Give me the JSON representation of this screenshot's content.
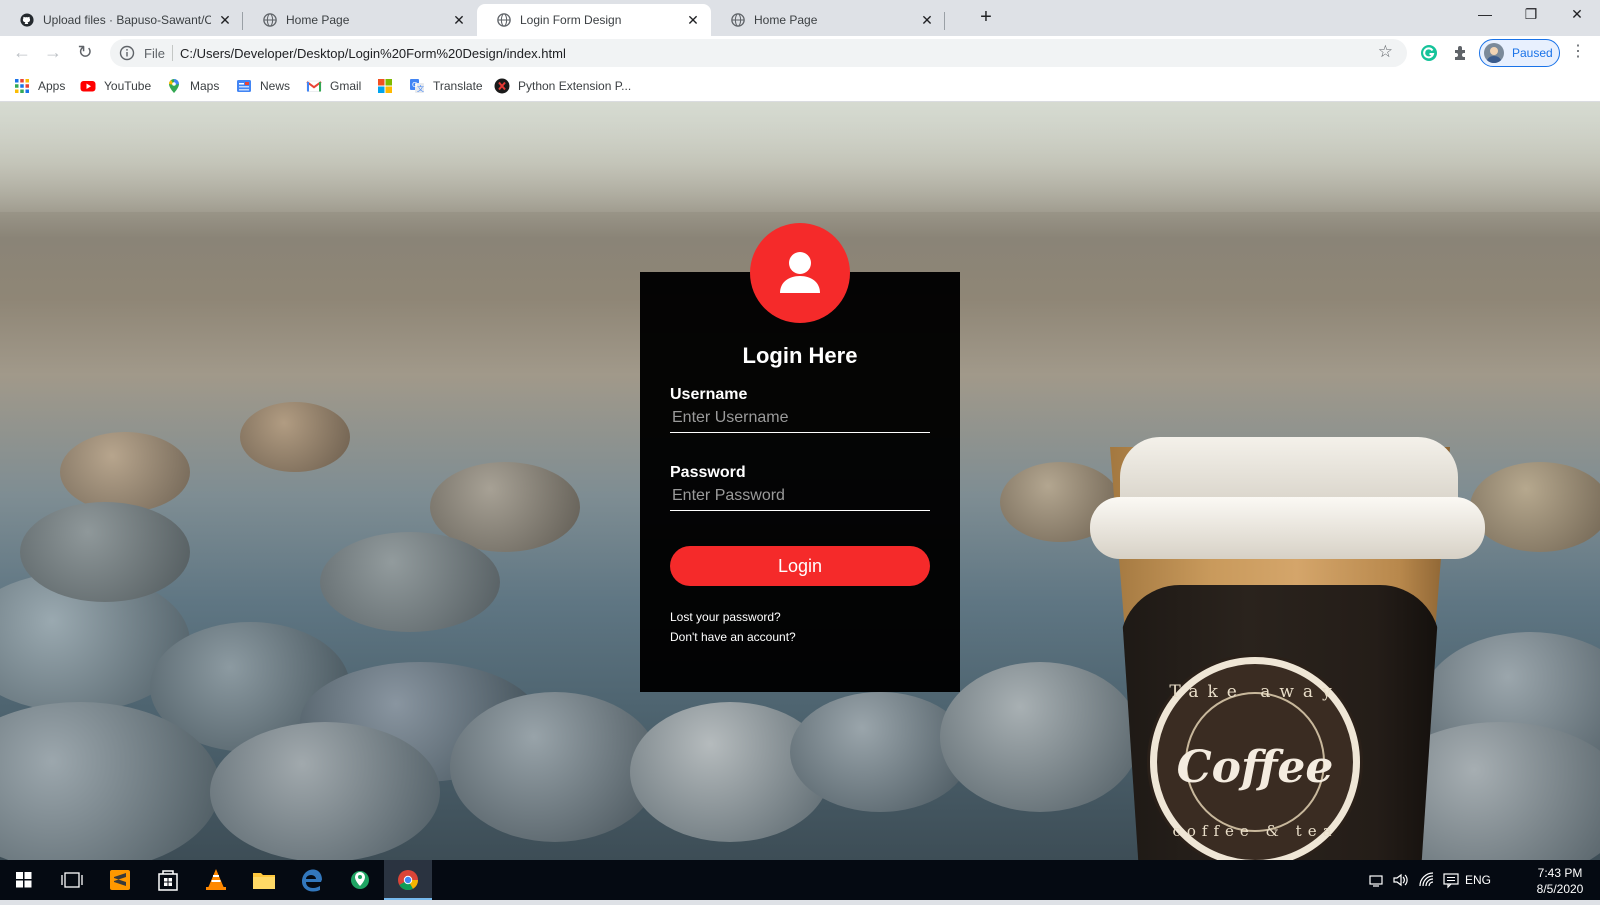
{
  "browser": {
    "tabs": [
      {
        "title": "Upload files · Bapuso-Sawant/CS",
        "icon": "github-icon",
        "active": false
      },
      {
        "title": "Home Page",
        "icon": "globe-icon",
        "active": false
      },
      {
        "title": "Login Form Design",
        "icon": "globe-icon",
        "active": true
      },
      {
        "title": "Home Page",
        "icon": "globe-icon",
        "active": false
      }
    ],
    "address": {
      "scheme_label": "File",
      "url": "C:/Users/Developer/Desktop/Login%20Form%20Design/index.html"
    },
    "profile_label": "Paused",
    "bookmarks": [
      {
        "label": "Apps",
        "icon": "apps-grid-icon"
      },
      {
        "label": "YouTube",
        "icon": "youtube-icon"
      },
      {
        "label": "Maps",
        "icon": "maps-pin-icon"
      },
      {
        "label": "News",
        "icon": "news-icon"
      },
      {
        "label": "Gmail",
        "icon": "gmail-icon"
      },
      {
        "label": "",
        "icon": "colorful-grid-icon"
      },
      {
        "label": "Translate",
        "icon": "translate-icon"
      },
      {
        "label": "Python Extension P...",
        "icon": "python-extension-icon"
      }
    ]
  },
  "login": {
    "title": "Login Here",
    "username_label": "Username",
    "username_placeholder": "Enter Username",
    "password_label": "Password",
    "password_placeholder": "Enter Password",
    "button_label": "Login",
    "lost_password": "Lost your password?",
    "no_account": "Don't have an account?",
    "accent_color": "#f52a2a"
  },
  "cup": {
    "badge_top": "Take away",
    "badge_word": "Coffee",
    "badge_bottom": "coffee & tea"
  },
  "taskbar": {
    "language": "ENG",
    "time": "7:43 PM",
    "date": "8/5/2020"
  }
}
